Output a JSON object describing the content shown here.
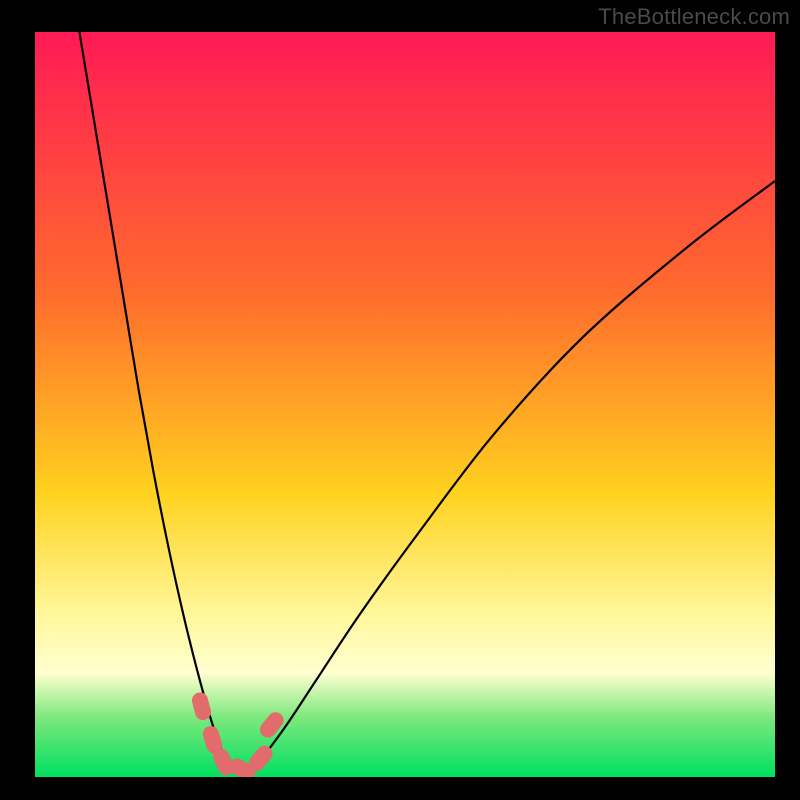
{
  "watermark": "TheBottleneck.com",
  "colors": {
    "frame": "#000000",
    "grad_top": "#ff1a55",
    "grad_mid1": "#ff6b2d",
    "grad_mid2": "#ffd21f",
    "grad_mid3": "#fff79a",
    "grad_bottom_band": "#ffffd0",
    "grad_green1": "#7de87d",
    "grad_green2": "#00e060",
    "curve": "#000000",
    "marker": "#e26b6b"
  },
  "chart_data": {
    "type": "line",
    "title": "",
    "xlabel": "",
    "ylabel": "",
    "xlim": [
      0,
      100
    ],
    "ylim": [
      0,
      100
    ],
    "series": [
      {
        "name": "bottleneck-curve",
        "x": [
          6,
          8,
          10,
          12,
          14,
          16,
          18,
          20,
          22,
          24,
          25.5,
          27,
          29,
          31,
          34,
          38,
          44,
          52,
          62,
          74,
          88,
          100
        ],
        "y": [
          100,
          88,
          76,
          64,
          52,
          41,
          31,
          22,
          14,
          7,
          3,
          1,
          1,
          3,
          7,
          13,
          22,
          33,
          46,
          59,
          71,
          80
        ]
      }
    ],
    "markers": [
      {
        "x": 22.5,
        "y": 9.5
      },
      {
        "x": 24.0,
        "y": 5.0
      },
      {
        "x": 25.5,
        "y": 2.0
      },
      {
        "x": 28.0,
        "y": 1.0
      },
      {
        "x": 30.5,
        "y": 2.5
      },
      {
        "x": 32.0,
        "y": 7.0
      }
    ],
    "gradient_bands": [
      {
        "pos": 0.0,
        "color": "#ff1a55"
      },
      {
        "pos": 0.35,
        "color": "#ff6b2d"
      },
      {
        "pos": 0.62,
        "color": "#ffd21f"
      },
      {
        "pos": 0.78,
        "color": "#fff79a"
      },
      {
        "pos": 0.86,
        "color": "#ffffd0"
      },
      {
        "pos": 0.92,
        "color": "#7de87d"
      },
      {
        "pos": 1.0,
        "color": "#00e060"
      }
    ]
  }
}
